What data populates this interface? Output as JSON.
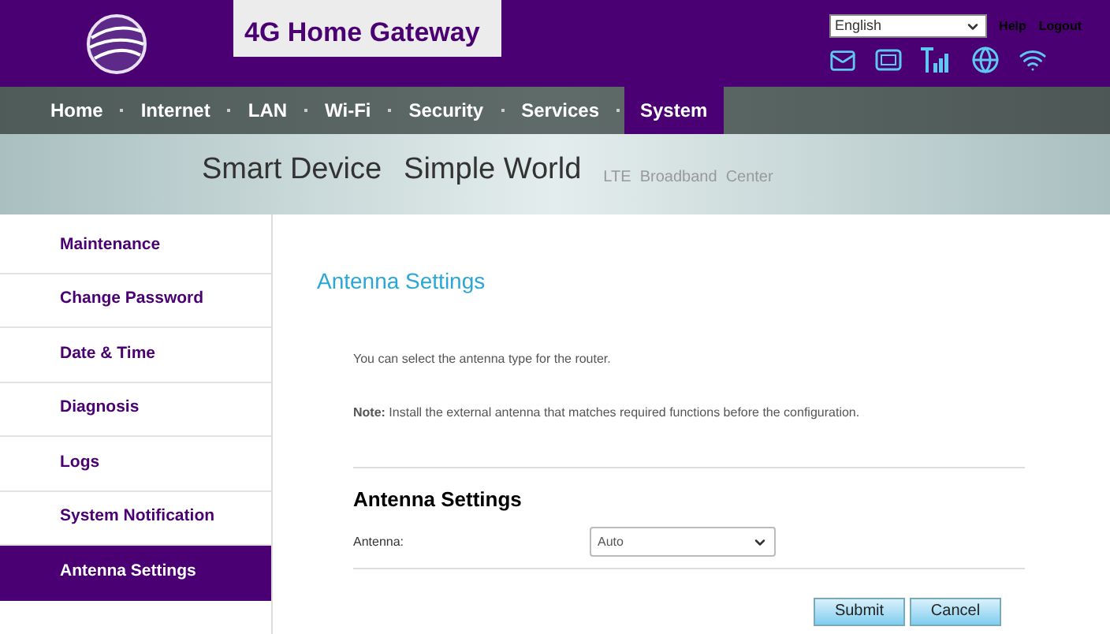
{
  "header": {
    "title": "4G Home Gateway",
    "language": "English",
    "links": [
      "Help",
      "Logout"
    ]
  },
  "nav": [
    {
      "label": "Home",
      "selected": false
    },
    {
      "label": "Internet",
      "selected": false
    },
    {
      "label": "LAN",
      "selected": false
    },
    {
      "label": "Wi-Fi",
      "selected": false
    },
    {
      "label": "Security",
      "selected": false
    },
    {
      "label": "Services",
      "selected": false
    },
    {
      "label": "System",
      "selected": true
    }
  ],
  "banner": {
    "slogan_1": "Smart Device",
    "slogan_2": "Simple World",
    "subtitle": "LTE  Broadband  Center"
  },
  "sidebar": [
    {
      "label": "Maintenance",
      "selected": false
    },
    {
      "label": "Change Password",
      "selected": false
    },
    {
      "label": "Date & Time",
      "selected": false
    },
    {
      "label": "Diagnosis",
      "selected": false
    },
    {
      "label": "Logs",
      "selected": false
    },
    {
      "label": "System Notification",
      "selected": false
    },
    {
      "label": "Antenna Settings",
      "selected": true
    }
  ],
  "content": {
    "page_title": "Antenna Settings",
    "intro": "You can select the antenna type for the router.",
    "note": "**Note:** Install the external antenna that matches required functions before the configuration.",
    "section_title": "Antenna Settings",
    "field_label": "Antenna:",
    "field_value": "Auto",
    "buttons": [
      "Submit",
      "Cancel"
    ]
  }
}
